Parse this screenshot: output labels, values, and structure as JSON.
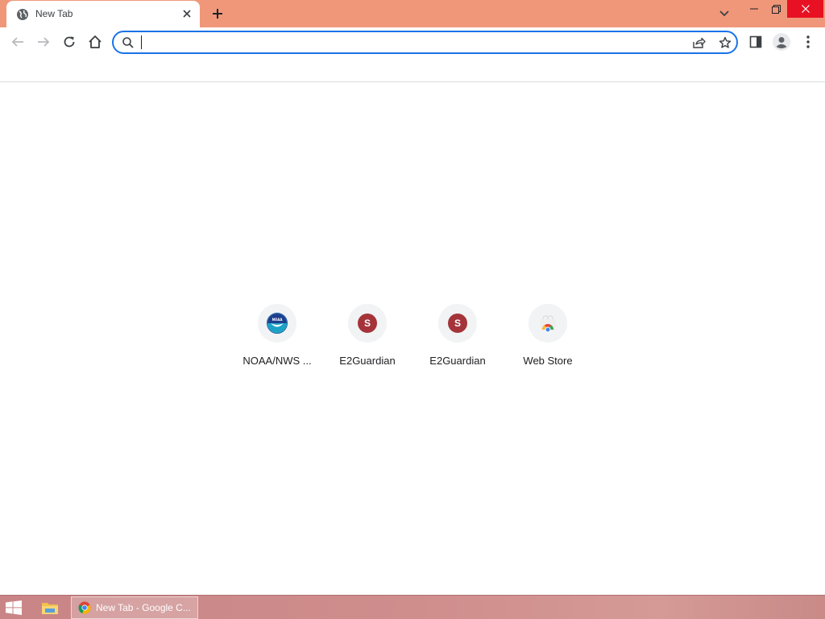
{
  "browser": {
    "tab": {
      "title": "New Tab",
      "favicon": "globe-icon"
    },
    "new_tab_icon": "plus-icon",
    "tab_search_icon": "chevron-down-icon",
    "window_controls": [
      "minimize-icon",
      "restore-icon",
      "close-icon"
    ],
    "theme_color": "#f0977a"
  },
  "toolbar": {
    "back_icon": "arrow-left-icon",
    "forward_icon": "arrow-right-icon",
    "reload_icon": "reload-icon",
    "home_icon": "home-icon",
    "omnibox": {
      "value": "",
      "placeholder": "",
      "search_icon": "search-icon"
    },
    "share_icon": "share-icon",
    "bookmark_icon": "star-icon",
    "side_panel_icon": "side-panel-icon",
    "profile_icon": "profile-icon",
    "menu_icon": "kebab-menu-icon",
    "focus_color": "#1a73e8"
  },
  "shortcuts": [
    {
      "label": "NOAA/NWS ...",
      "icon": "noaa-logo-icon"
    },
    {
      "label": "E2Guardian",
      "letter": "S",
      "color": "#a4343a"
    },
    {
      "label": "E2Guardian",
      "letter": "S",
      "color": "#a4343a"
    },
    {
      "label": "Web Store",
      "icon": "web-store-icon"
    }
  ],
  "taskbar": {
    "start_icon": "windows-icon",
    "explorer_icon": "file-explorer-icon",
    "active_window": {
      "label": "New Tab - Google C...",
      "icon": "chrome-icon"
    }
  }
}
